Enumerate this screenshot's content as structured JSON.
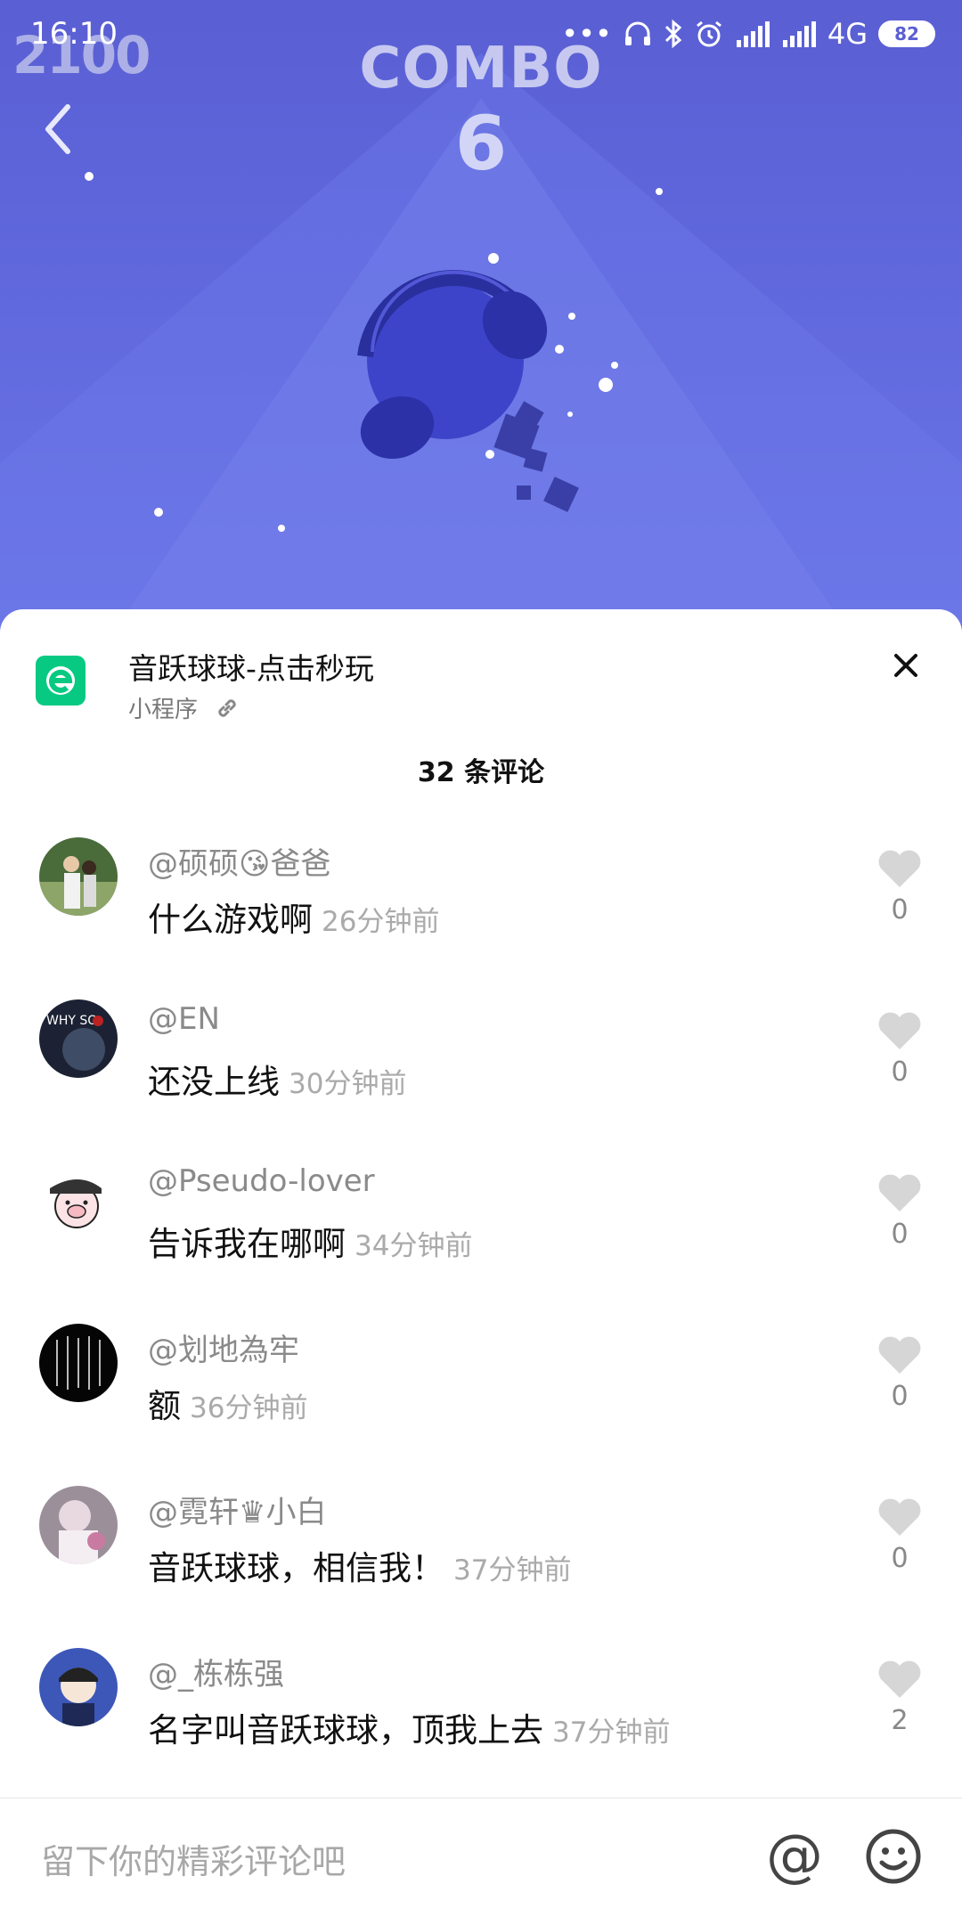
{
  "status_bar": {
    "time": "16:10",
    "network": "4G",
    "battery": "82"
  },
  "game": {
    "score": "2100",
    "combo_label": "COMBO",
    "combo_value": "6"
  },
  "mini_program": {
    "title": "音跃球球-点击秒玩",
    "type_label": "小程序"
  },
  "comments_header": "32 条评论",
  "comments": [
    {
      "user": "@硕硕😘爸爸",
      "text": "什么游戏啊",
      "time": "26分钟前",
      "likes": "0"
    },
    {
      "user": "@EN",
      "text": "还没上线",
      "time": "30分钟前",
      "likes": "0"
    },
    {
      "user": "@Pseudo-lover",
      "text": "告诉我在哪啊",
      "time": "34分钟前",
      "likes": "0"
    },
    {
      "user": "@划地為牢",
      "text": "额",
      "time": "36分钟前",
      "likes": "0"
    },
    {
      "user": "@霓轩♛小白",
      "text": "音跃球球，相信我！",
      "time": "37分钟前",
      "likes": "0"
    },
    {
      "user": "@_栋栋强",
      "text": "名字叫音跃球球，顶我上去",
      "time": "37分钟前",
      "likes": "2"
    }
  ],
  "input": {
    "placeholder": "留下你的精彩评论吧",
    "at_symbol": "@"
  },
  "colors": {
    "game_bg": "#5f67dc",
    "mini_program_green": "#07c982"
  }
}
